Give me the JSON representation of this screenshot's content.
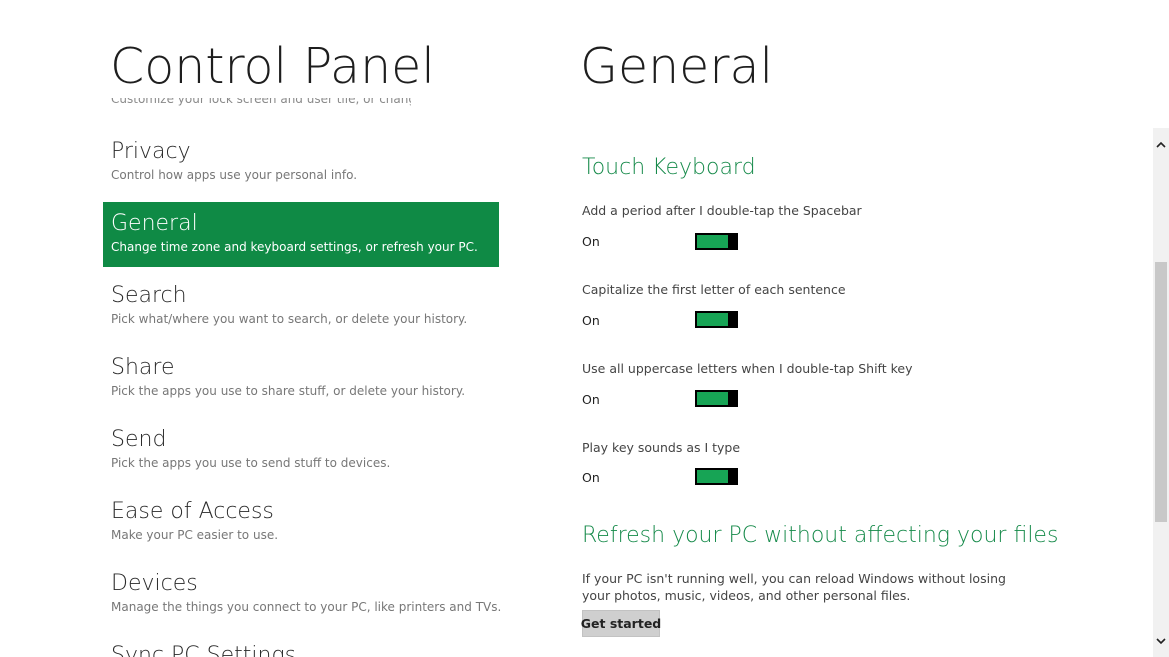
{
  "left": {
    "title": "Control Panel",
    "cut_text": "Customize your lock screen and user tile, or change your password and more",
    "categories": [
      {
        "name": "Privacy",
        "desc": "Control how apps use your personal info."
      },
      {
        "name": "General",
        "desc": "Change time zone and keyboard settings, or refresh your PC.",
        "selected": true
      },
      {
        "name": "Search",
        "desc": "Pick what/where you want to search, or delete your history."
      },
      {
        "name": "Share",
        "desc": "Pick the apps you use to share stuff, or delete your history."
      },
      {
        "name": "Send",
        "desc": "Pick the apps you use to send stuff to devices."
      },
      {
        "name": "Ease of Access",
        "desc": "Make your PC easier to use."
      },
      {
        "name": "Devices",
        "desc": "Manage the things you connect to your PC, like printers and TVs."
      },
      {
        "name": "Sync PC Settings",
        "desc": ""
      }
    ]
  },
  "right": {
    "title": "General",
    "touch_keyboard": {
      "title": "Touch Keyboard",
      "settings": [
        {
          "label": "Add a period after I double-tap the Spacebar",
          "state": "On"
        },
        {
          "label": "Capitalize the first letter of each sentence",
          "state": "On"
        },
        {
          "label": "Use all uppercase letters when I double-tap Shift key",
          "state": "On"
        },
        {
          "label": "Play key sounds as I type",
          "state": "On"
        }
      ]
    },
    "refresh": {
      "title": "Refresh your PC without affecting your files",
      "desc": "If your PC isn't running well, you can reload Windows without losing your photos, music, videos, and other personal files.",
      "button": "Get started"
    }
  },
  "colors": {
    "accent": "#0f8a45",
    "section_title": "#168a4a",
    "toggle_on": "#17a455"
  },
  "icons": {
    "scroll_up": "chevron-up-icon",
    "scroll_down": "chevron-down-icon"
  }
}
